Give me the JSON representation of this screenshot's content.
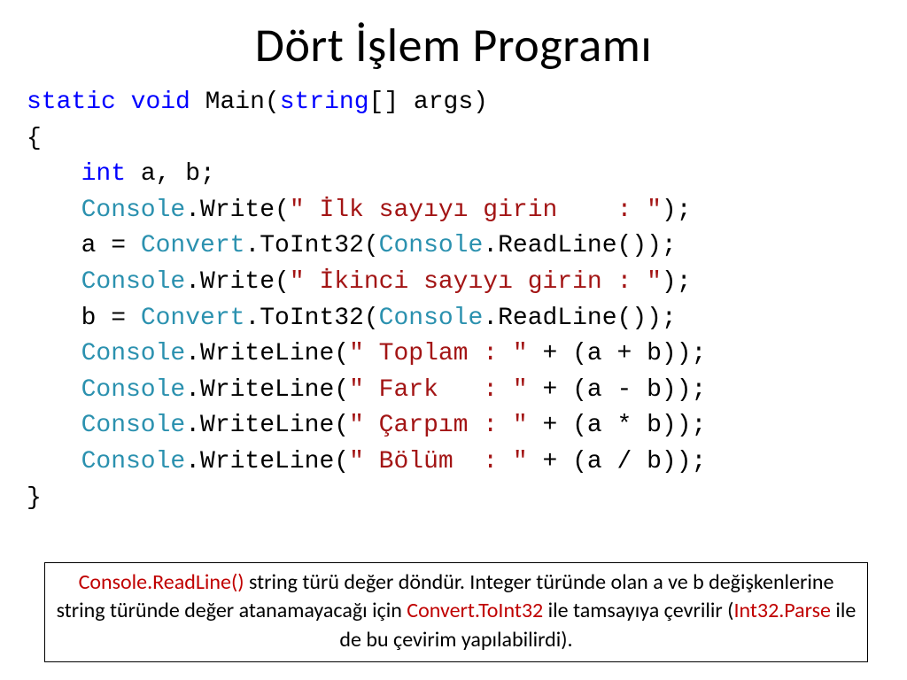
{
  "title": "Dört İşlem Programı",
  "code": {
    "l1_kw_static": "static",
    "l1_kw_void": "void",
    "l1_main": " Main(",
    "l1_kw_string": "string",
    "l1_rest": "[] args)",
    "l2": "{",
    "l3_kw_int": "int",
    "l3_rest": " a, b;",
    "l4_console": "Console",
    "l4_write": ".Write(",
    "l4_str": "\" İlk sayıyı girin    : \"",
    "l4_end": ");",
    "l5_a": "a = ",
    "l5_convert": "Convert",
    "l5_toint": ".ToInt32(",
    "l5_console": "Console",
    "l5_readline": ".ReadLine());",
    "l6_console": "Console",
    "l6_write": ".Write(",
    "l6_str": "\" İkinci sayıyı girin : \"",
    "l6_end": ");",
    "l7_b": "b = ",
    "l7_convert": "Convert",
    "l7_toint": ".ToInt32(",
    "l7_console": "Console",
    "l7_readline": ".ReadLine());",
    "l8_console": "Console",
    "l8_write": ".WriteLine(",
    "l8_str": "\" Toplam : \"",
    "l8_end": " + (a + b));",
    "l9_console": "Console",
    "l9_write": ".WriteLine(",
    "l9_str": "\" Fark   : \"",
    "l9_end": " + (a - b));",
    "l10_console": "Console",
    "l10_write": ".WriteLine(",
    "l10_str": "\" Çarpım : \"",
    "l10_end": " + (a * b));",
    "l11_console": "Console",
    "l11_write": ".WriteLine(",
    "l11_str": "\" Bölüm  : \"",
    "l11_end": " + (a / b));",
    "l12": "}"
  },
  "note": {
    "p1a": "Console.ReadLine()",
    "p1b": " string türü değer döndür. Integer türünde olan a ve b değişkenlerine string türünde değer atanamayacağı için ",
    "p1c": "Convert.ToInt32",
    "p1d": " ile tamsayıya çevrilir (",
    "p1e": "Int32.Parse",
    "p1f": " ile de bu çevirim yapılabilirdi)."
  }
}
